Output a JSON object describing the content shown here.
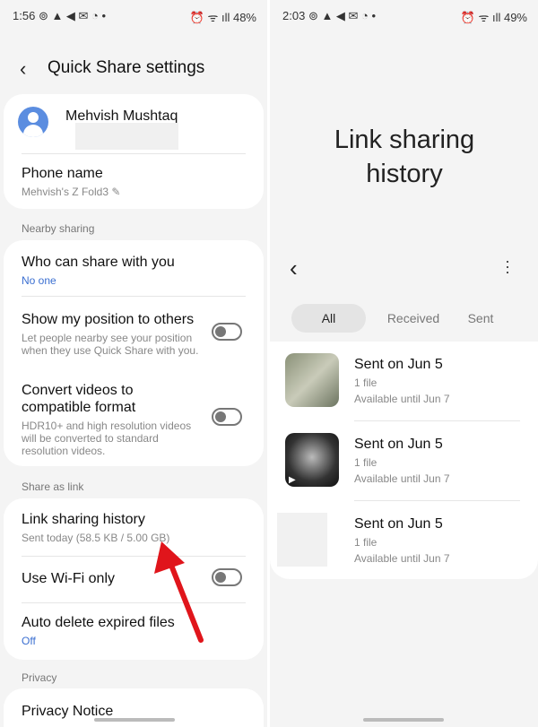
{
  "left": {
    "status": {
      "time": "1:56",
      "icons": "⊚ ▲ ◀ ✉ ◔ •",
      "right": "⏰ ᯤ ıll 48%"
    },
    "title": "Quick Share settings",
    "profile_name": "Mehvish Mushtaq",
    "phone_name": {
      "label": "Phone name",
      "value": "Mehvish's Z Fold3"
    },
    "nearby_header": "Nearby sharing",
    "who_can_share": {
      "label": "Who can share with you",
      "value": "No one"
    },
    "show_position": {
      "label": "Show my position to others",
      "desc": "Let people nearby see your position when they use Quick Share with you.",
      "on": false
    },
    "convert_videos": {
      "label": "Convert videos to compatible format",
      "desc": "HDR10+ and high resolution videos will be converted to standard resolution videos.",
      "on": false
    },
    "link_header": "Share as link",
    "link_history": {
      "label": "Link sharing history",
      "value": "Sent today (58.5 KB / 5.00 GB)"
    },
    "wifi_only": {
      "label": "Use Wi-Fi only",
      "on": false
    },
    "auto_delete": {
      "label": "Auto delete expired files",
      "value": "Off"
    },
    "privacy_header": "Privacy",
    "privacy_notice": "Privacy Notice"
  },
  "right": {
    "status": {
      "time": "2:03",
      "icons": "⊚ ▲ ◀ ✉ ◔ •",
      "right": "⏰ ᯤ ıll 49%"
    },
    "title": "Link sharing history",
    "tabs": [
      {
        "label": "All",
        "active": true
      },
      {
        "label": "Received"
      },
      {
        "label": "Sent"
      }
    ],
    "items": [
      {
        "title": "Sent on Jun 5",
        "count": "1 file",
        "expiry": "Available until Jun 7"
      },
      {
        "title": "Sent on Jun 5",
        "count": "1 file",
        "expiry": "Available until Jun 7"
      },
      {
        "title": "Sent on Jun 5",
        "count": "1 file",
        "expiry": "Available until Jun 7"
      }
    ]
  },
  "colors": {
    "accent": "#3b6fd1",
    "annotation_arrow": "#e0151b",
    "avatar": "#5b8de0"
  }
}
